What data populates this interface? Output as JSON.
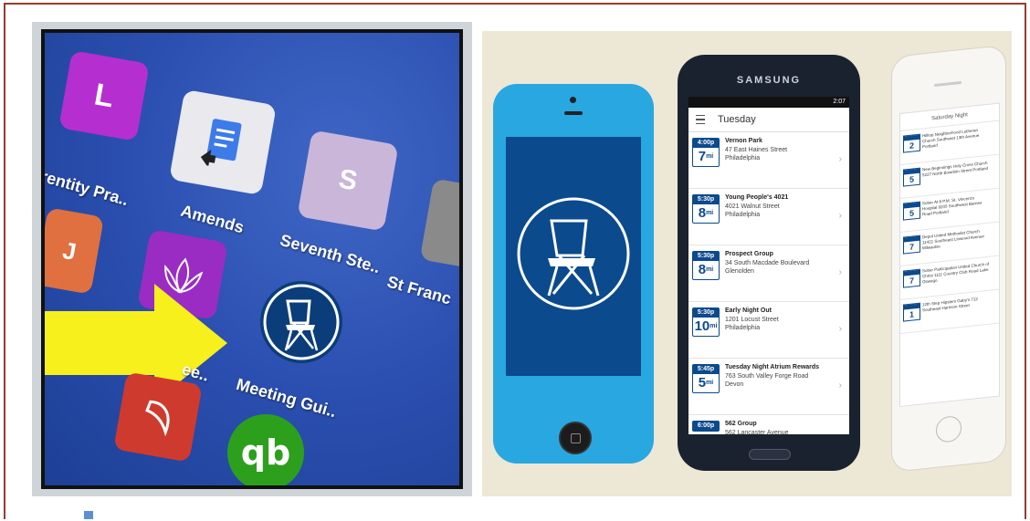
{
  "left_photo": {
    "apps": [
      {
        "label": "rentity Pra..",
        "tile_letter": "L",
        "tile_color": "#b52fd0"
      },
      {
        "label": "Amends",
        "tile_color": "#e9e9ee"
      },
      {
        "label": "Seventh Ste..",
        "tile_letter": "S",
        "tile_color": "#c9b6d8"
      },
      {
        "label": "St Franc",
        "tile_color": "#8a8a8a"
      },
      {
        "label": "ee..",
        "tile_letter": "J",
        "tile_color": "#e07040"
      },
      {
        "label": "Meeting Gui..",
        "tile_color": "#0b3d7a"
      }
    ],
    "bottom_apps": [
      "chili-app-icon",
      "quickbooks-icon"
    ],
    "quickbooks_text": "qb",
    "arrow_color": "#f7f01c"
  },
  "samsung": {
    "brand": "SAMSUNG",
    "status_time": "2:07",
    "day": "Tuesday",
    "meetings": [
      {
        "time": "4:00p",
        "dist": "7",
        "unit": "mi",
        "name": "Vernon Park",
        "address": "47 East Haines Street",
        "city": "Philadelphia"
      },
      {
        "time": "5:30p",
        "dist": "8",
        "unit": "mi",
        "name": "Young People's 4021",
        "address": "4021 Walnut Street",
        "city": "Philadelphia"
      },
      {
        "time": "5:30p",
        "dist": "8",
        "unit": "mi",
        "name": "Prospect Group",
        "address": "34 South Macdade Boulevard",
        "city": "Glenolden"
      },
      {
        "time": "5:30p",
        "dist": "10",
        "unit": "mi",
        "name": "Early Night Out",
        "address": "1201 Locust Street",
        "city": "Philadelphia"
      },
      {
        "time": "5:45p",
        "dist": "5",
        "unit": "mi",
        "name": "Tuesday Night Atrium Rewards",
        "address": "763 South Valley Forge Road",
        "city": "Devon"
      },
      {
        "time": "6:00p",
        "dist": "",
        "unit": "",
        "name": "562 Group",
        "address": "562 Lancaster Avenue",
        "city": ""
      }
    ]
  },
  "iphone6": {
    "header": "Saturday Night",
    "meetings": [
      {
        "dist": "2",
        "text": "Hilltop Neighborhood Lutheran Church Southeast 13th Avenue Portland"
      },
      {
        "dist": "5",
        "text": "New Beginnings Holy Cross Church 5227 North Bowdoin Street Portland"
      },
      {
        "dist": "5",
        "text": "Sober At 8 P.M. St. Vincent's Hospital 9205 Southwest Barnes Road Portland"
      },
      {
        "dist": "7",
        "text": "Depot United Methodist Church 11421 Southeast Linwood Avenue Milwaukie"
      },
      {
        "dist": "7",
        "text": "Sober Participation United Church of Christ 1111 Country Club Road Lake Oswego"
      },
      {
        "dist": "1",
        "text": "12th Step Hipsters Gaby's 712 Southeast Harrison Street"
      }
    ]
  },
  "colors": {
    "brand_blue": "#0b4a8d",
    "frame": "#9b3a2e"
  }
}
